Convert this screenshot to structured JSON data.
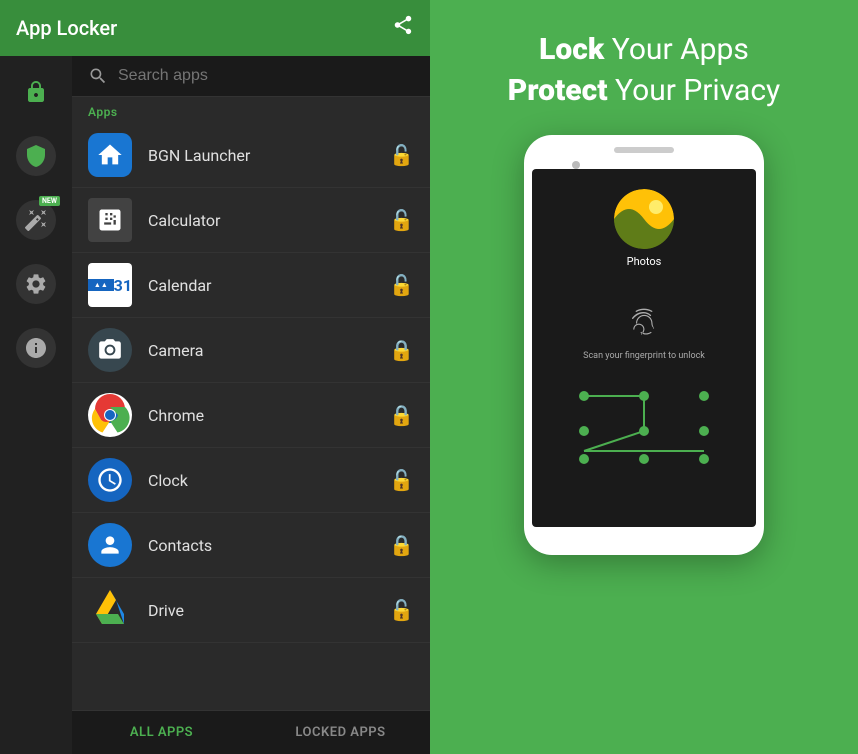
{
  "header": {
    "title": "App Locker",
    "share_label": "share"
  },
  "search": {
    "placeholder": "Search apps"
  },
  "sections": {
    "apps_label": "Apps"
  },
  "nav_icons": [
    {
      "name": "lock-nav",
      "label": "Lock"
    },
    {
      "name": "shield-nav",
      "label": "Shield"
    },
    {
      "name": "magic-nav",
      "label": "Magic",
      "badge": "NEW"
    },
    {
      "name": "settings-nav",
      "label": "Settings"
    },
    {
      "name": "info-nav",
      "label": "Info"
    }
  ],
  "apps": [
    {
      "name": "BGN Launcher",
      "locked": false,
      "icon": "🏠"
    },
    {
      "name": "Calculator",
      "locked": false,
      "icon": "🧮"
    },
    {
      "name": "Calendar",
      "locked": false,
      "icon": "📅"
    },
    {
      "name": "Camera",
      "locked": true,
      "icon": "📷"
    },
    {
      "name": "Chrome",
      "locked": true,
      "icon": "🌐"
    },
    {
      "name": "Clock",
      "locked": false,
      "icon": "🕐"
    },
    {
      "name": "Contacts",
      "locked": true,
      "icon": "👤"
    },
    {
      "name": "Drive",
      "locked": false,
      "icon": "💾"
    }
  ],
  "tabs": [
    {
      "id": "all",
      "label": "ALL APPS",
      "active": true
    },
    {
      "id": "locked",
      "label": "LOCKED APPS",
      "active": false
    }
  ],
  "promo": {
    "line1_bold": "Lock",
    "line1_rest": " Your Apps",
    "line2_bold": "Protect",
    "line2_rest": " Your Privacy"
  },
  "phone_screen": {
    "app_name": "Photos",
    "fingerprint_text": "Scan your fingerprint to unlock"
  },
  "colors": {
    "green": "#4CAF50",
    "dark_green": "#388E3C",
    "dark_bg": "#2a2a2a",
    "darker_bg": "#1a1a1a"
  }
}
